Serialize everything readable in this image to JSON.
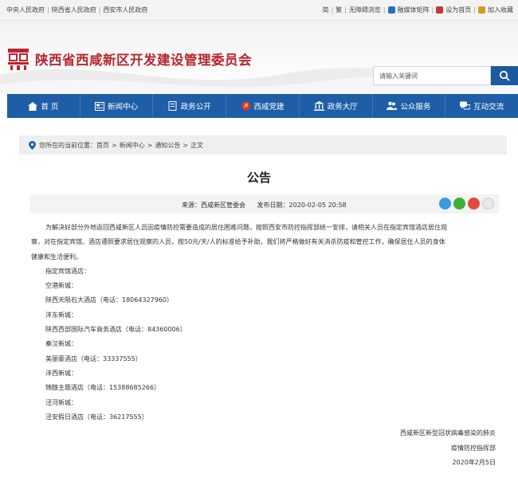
{
  "topbar": {
    "links": [
      "中央人民政府",
      "陕西省人民政府",
      "西安市人民政府"
    ],
    "right": [
      {
        "label": "简",
        "icon": ""
      },
      {
        "label": "繁",
        "icon": ""
      },
      {
        "label": "无障碍浏览",
        "icon": ""
      },
      {
        "label": "融媒体矩阵",
        "icon": "media-icon"
      },
      {
        "label": "设为首页",
        "icon": "home-icon"
      },
      {
        "label": "加入收藏",
        "icon": "star-icon"
      }
    ]
  },
  "header": {
    "site_title": "陕西省西咸新区开发建设管理委员会",
    "search_placeholder": "请输入关键词"
  },
  "nav": [
    {
      "label": "首 页",
      "icon": "home-icon"
    },
    {
      "label": "新闻中心",
      "icon": "news-icon"
    },
    {
      "label": "政务公开",
      "icon": "document-icon"
    },
    {
      "label": "西咸党建",
      "icon": "party-icon"
    },
    {
      "label": "政务大厅",
      "icon": "hall-icon"
    },
    {
      "label": "公众服务",
      "icon": "people-icon"
    },
    {
      "label": "互动交流",
      "icon": "chat-icon"
    }
  ],
  "breadcrumb": {
    "prefix": "您所在的当前位置：",
    "items": [
      "首页",
      "新闻中心",
      "通知公告",
      "正文"
    ],
    "separator": ">"
  },
  "article": {
    "title": "公告",
    "source": "来源：西咸新区管委会",
    "date": "发布日期：2020-02-05 20:58",
    "paragraph_lines": [
      "为解决好部分外地返回西咸新区人员因疫情防控需要造成的居住困难问题，按照西安市防控指挥部统一安排，请相关人员在指定宾馆酒店居住观",
      "察，对在指定宾馆、酒店遵照要求居住观察的人员，按50元/天/人的标准给予补助，我们将严格做好有关消杀防疫和管控工作，确保居住人员的身体",
      "健康和生活便利。"
    ],
    "lines": [
      "指定宾馆酒店：",
      "空港新城：",
      "陕西天陨石大酒店（电话：18064327960）",
      "沣东新城：",
      "陕西西部国际汽车商务酒店（电话：84360006）",
      "秦汉新城：",
      "美丽豪酒店（电话：33337555）",
      "沣西新城：",
      "锦醇主题酒店（电话：15388685266）",
      "泾河新城：",
      "泾安假日酒店（电话：36217555）"
    ],
    "signature": [
      "西咸新区新型冠状病毒感染的肺炎",
      "疫情防控指挥部",
      "2020年2月5日"
    ]
  },
  "share_icons": [
    "qq-icon",
    "wechat-icon",
    "weibo-icon",
    "copy-icon"
  ],
  "colors": {
    "brand_red": "#b8262f",
    "nav_blue": "#1e5ea6",
    "search_blue": "#1b5aa0"
  }
}
